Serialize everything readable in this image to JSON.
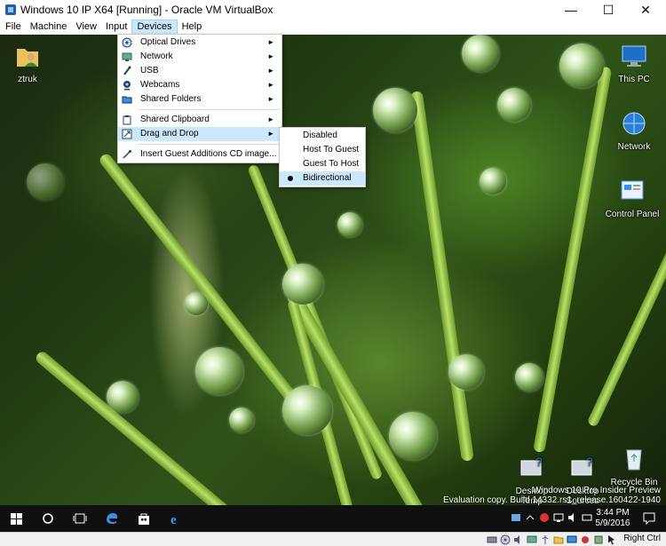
{
  "window": {
    "title": "Windows 10 IP X64 [Running] - Oracle VM VirtualBox",
    "minimize": "—",
    "maximize": "☐",
    "close": "✕"
  },
  "menubar": [
    "File",
    "Machine",
    "View",
    "Input",
    "Devices",
    "Help"
  ],
  "devices_menu": {
    "items": [
      {
        "label": "Optical Drives",
        "icon": "optical-drive-icon",
        "submenu": true
      },
      {
        "label": "Network",
        "icon": "network-icon",
        "submenu": true
      },
      {
        "label": "USB",
        "icon": "usb-icon",
        "submenu": true
      },
      {
        "label": "Webcams",
        "icon": "webcam-icon",
        "submenu": true
      },
      {
        "label": "Shared Folders",
        "icon": "shared-folder-icon",
        "submenu": true
      },
      {
        "label": "Shared Clipboard",
        "icon": "clipboard-icon",
        "submenu": true
      },
      {
        "label": "Drag and Drop",
        "icon": "drag-drop-icon",
        "submenu": true
      },
      {
        "label": "Insert Guest Additions CD image...",
        "icon": "cd-insert-icon",
        "submenu": false
      }
    ],
    "arrow": "►"
  },
  "drag_drop_submenu": {
    "items": [
      "Disabled",
      "Host To Guest",
      "Guest To Host",
      "Bidirectional"
    ],
    "selected": "Bidirectional"
  },
  "desktop": {
    "icons": [
      {
        "label": "ztruk",
        "icon": "user-folder-icon"
      },
      {
        "label": "This PC",
        "icon": "this-pc-icon"
      },
      {
        "label": "Network",
        "icon": "network-desktop-icon"
      },
      {
        "label": "Control Panel",
        "icon": "control-panel-icon"
      },
      {
        "label": "Desktop Temp",
        "icon": "desktop-temp-icon"
      },
      {
        "label": "Desktop Sources",
        "icon": "desktop-sources-icon"
      },
      {
        "label": "Recycle Bin",
        "icon": "recycle-bin-icon"
      }
    ],
    "watermark_line1": "Windows 10 Pro Insider Preview",
    "watermark_line2": "Evaluation copy. Build 14332.rs1_release.160422-1940"
  },
  "taskbar": {
    "time": "3:44 PM",
    "date": "5/9/2016"
  },
  "statusbar": {
    "host_key": "Right Ctrl"
  },
  "colors": {
    "menu_highlight": "#cce8ff",
    "taskbar": "#101010"
  }
}
